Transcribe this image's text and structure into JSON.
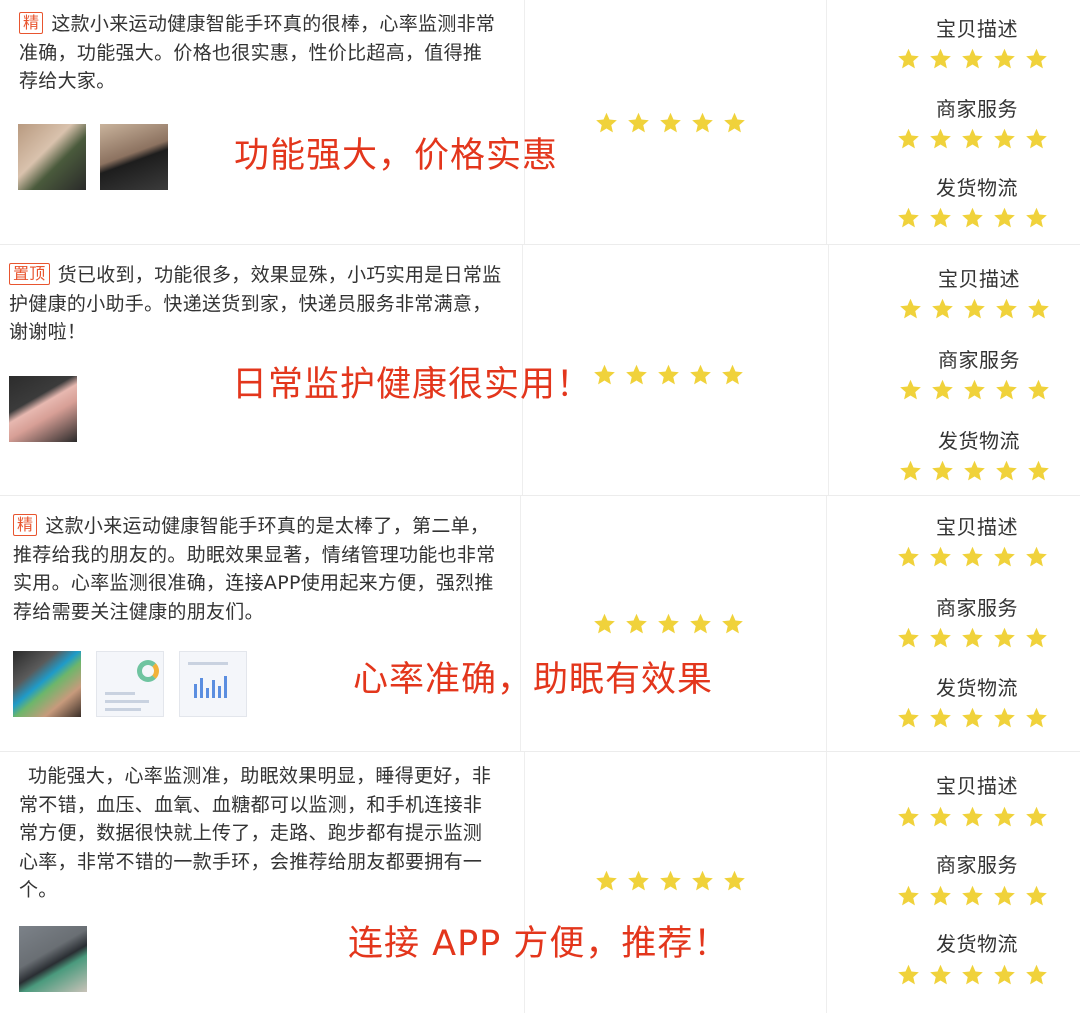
{
  "colors": {
    "star": "#f0d23b",
    "headline": "#e3361c",
    "badge": "#e8552f"
  },
  "rating_labels": {
    "description": "宝贝描述",
    "service": "商家服务",
    "shipping": "发货物流"
  },
  "reviews": [
    {
      "badge": "精",
      "text": "这款小来运动健康智能手环真的很棒，心率监测非常准确，功能强大。价格也很实惠，性价比超高，值得推荐给大家。",
      "headline": "功能强大，价格实惠",
      "overall_stars": 5,
      "description_stars": 5,
      "service_stars": 5,
      "shipping_stars": 5
    },
    {
      "badge": "置顶",
      "text": "货已收到，功能很多，效果显殊，小巧实用是日常监护健康的小助手。快递送货到家，快递员服务非常满意，谢谢啦！",
      "headline": "日常监护健康很实用！",
      "overall_stars": 5,
      "description_stars": 5,
      "service_stars": 5,
      "shipping_stars": 5
    },
    {
      "badge": "精",
      "text": "这款小来运动健康智能手环真的是太棒了，第二单，推荐给我的朋友的。助眠效果显著，情绪管理功能也非常实用。心率监测很准确，连接APP使用起来方便，强烈推荐给需要关注健康的朋友们。",
      "headline": "心率准确，助眠有效果",
      "overall_stars": 5,
      "description_stars": 5,
      "service_stars": 5,
      "shipping_stars": 5
    },
    {
      "badge": "",
      "text": "功能强大，心率监测准，助眠效果明显，睡得更好，非常不错，血压、血氧、血糖都可以监测，和手机连接非常方便，数据很快就上传了，走路、跑步都有提示监测心率，非常不错的一款手环，会推荐给朋友都要拥有一个。",
      "headline": "连接 APP 方便，推荐！",
      "overall_stars": 5,
      "description_stars": 5,
      "service_stars": 5,
      "shipping_stars": 5
    }
  ]
}
